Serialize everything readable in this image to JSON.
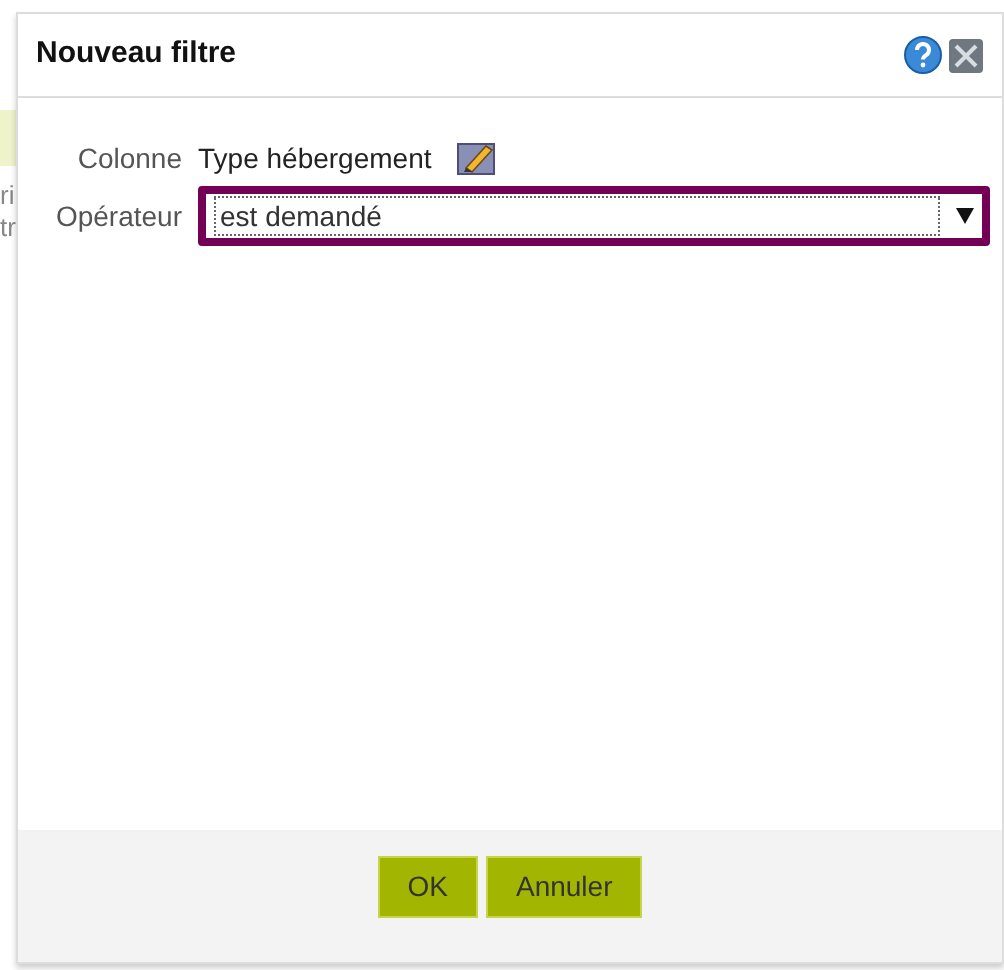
{
  "background": {
    "fragments": [
      "ri",
      "tr"
    ]
  },
  "dialog": {
    "title": "Nouveau filtre",
    "fields": [
      {
        "kind": "text",
        "label": "Colonne",
        "value": "Type hébergement"
      },
      {
        "kind": "select",
        "label": "Opérateur",
        "value": "est demandé",
        "focused": true
      }
    ],
    "buttons": [
      "OK",
      "Annuler"
    ]
  }
}
